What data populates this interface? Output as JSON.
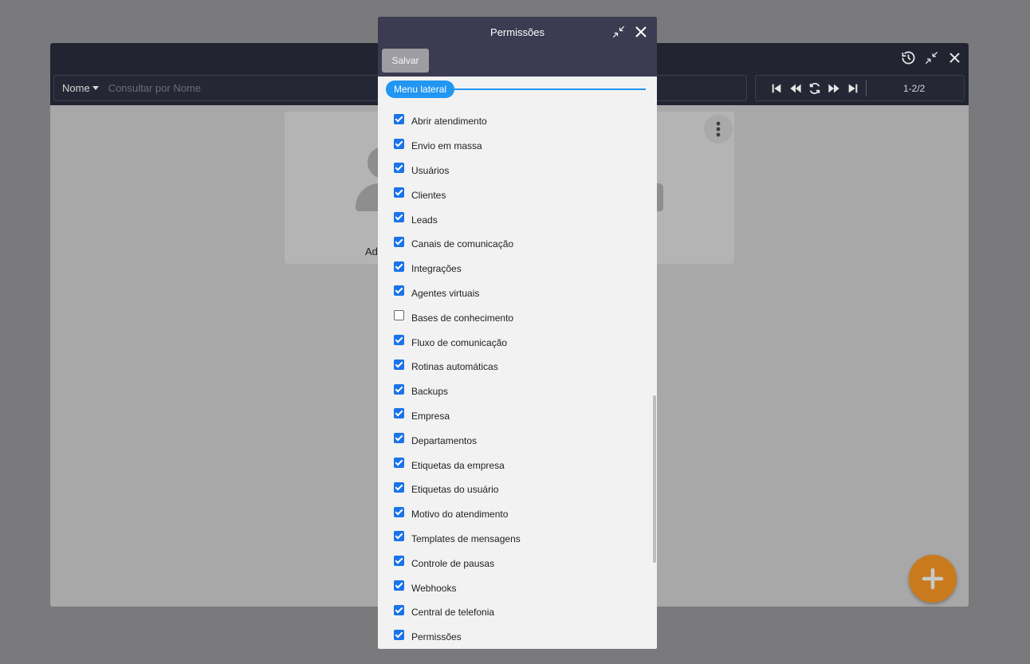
{
  "background": {
    "search": {
      "filter_label": "Nome",
      "placeholder": "Consultar por Nome"
    },
    "pager": {
      "count": "1-2/2"
    },
    "card": {
      "name": "Adm"
    }
  },
  "dialog": {
    "title": "Permissões",
    "save_label": "Salvar",
    "section_label": "Menu lateral",
    "permissions": [
      {
        "label": "Abrir atendimento",
        "checked": true
      },
      {
        "label": "Envio em massa",
        "checked": true
      },
      {
        "label": "Usuários",
        "checked": true
      },
      {
        "label": "Clientes",
        "checked": true
      },
      {
        "label": "Leads",
        "checked": true
      },
      {
        "label": "Canais de comunicação",
        "checked": true
      },
      {
        "label": "Integrações",
        "checked": true
      },
      {
        "label": "Agentes virtuais",
        "checked": true
      },
      {
        "label": "Bases de conhecimento",
        "checked": false
      },
      {
        "label": "Fluxo de comunicação",
        "checked": true
      },
      {
        "label": "Rotinas automáticas",
        "checked": true
      },
      {
        "label": "Backups",
        "checked": true
      },
      {
        "label": "Empresa",
        "checked": true
      },
      {
        "label": "Departamentos",
        "checked": true
      },
      {
        "label": "Etiquetas da empresa",
        "checked": true
      },
      {
        "label": "Etiquetas do usuário",
        "checked": true
      },
      {
        "label": "Motivo do atendimento",
        "checked": true
      },
      {
        "label": "Templates de mensagens",
        "checked": true
      },
      {
        "label": "Controle de pausas",
        "checked": true
      },
      {
        "label": "Webhooks",
        "checked": true
      },
      {
        "label": "Central de telefonia",
        "checked": true
      },
      {
        "label": "Permissões",
        "checked": true
      }
    ]
  },
  "colors": {
    "accent": "#2196f3",
    "checkbox": "#1a73e8",
    "fab": "#c97a1c",
    "header": "#3b3b52"
  }
}
